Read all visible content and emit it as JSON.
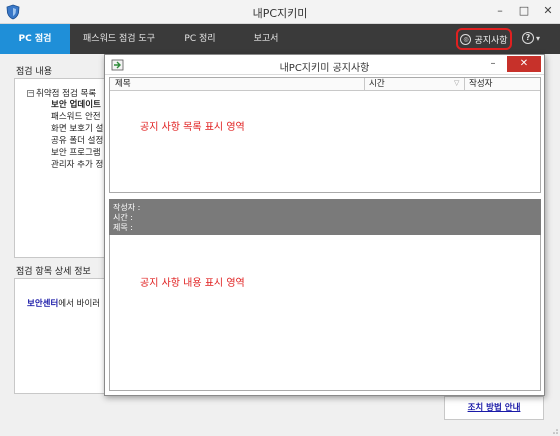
{
  "window": {
    "title": "내PC지키미",
    "minimize": "–",
    "maximize": "□",
    "close": "✕"
  },
  "tabs": [
    {
      "label": "PC 점검",
      "active": true
    },
    {
      "label": "패스워드 점검 도구",
      "active": false
    },
    {
      "label": "PC 정리",
      "active": false
    },
    {
      "label": "보고서",
      "active": false
    }
  ],
  "header_actions": {
    "notice_label": "공지사항",
    "help_icon": "?",
    "help_arrow": "▾"
  },
  "left": {
    "inspection_title": "점검 내용",
    "tree_root_toggle": "−",
    "tree_root": "취약점 점검 목록",
    "tree_items": [
      "보안 업데이트",
      "패스워드 안전",
      "화면 보호기 설",
      "공유 폴더 설정",
      "보안 프로그램",
      "관리자 추가 정"
    ],
    "detail_title": "점검 항목 상세 정보",
    "detail_link": "보안센터",
    "detail_suffix": "에서 바이러"
  },
  "fix_link": "조치 방법 안내",
  "popup": {
    "title": "내PC지키미 공지사항",
    "minimize": "–",
    "close": "✕",
    "columns": [
      "제목",
      "시간",
      "작성자"
    ],
    "sort_icon": "▽",
    "list_placeholder": "공지 사항 목록 표시 영역",
    "info_author": "작성자 :",
    "info_time": "시간    :",
    "info_title": "제목    :",
    "content_placeholder": "공지 사항 내용 표시 영역"
  },
  "colors": {
    "accent": "#1f8fd8",
    "highlight": "#e02020",
    "tabbar": "#3a3a3a",
    "info_bar": "#7a7a7a",
    "close": "#c7312a"
  }
}
